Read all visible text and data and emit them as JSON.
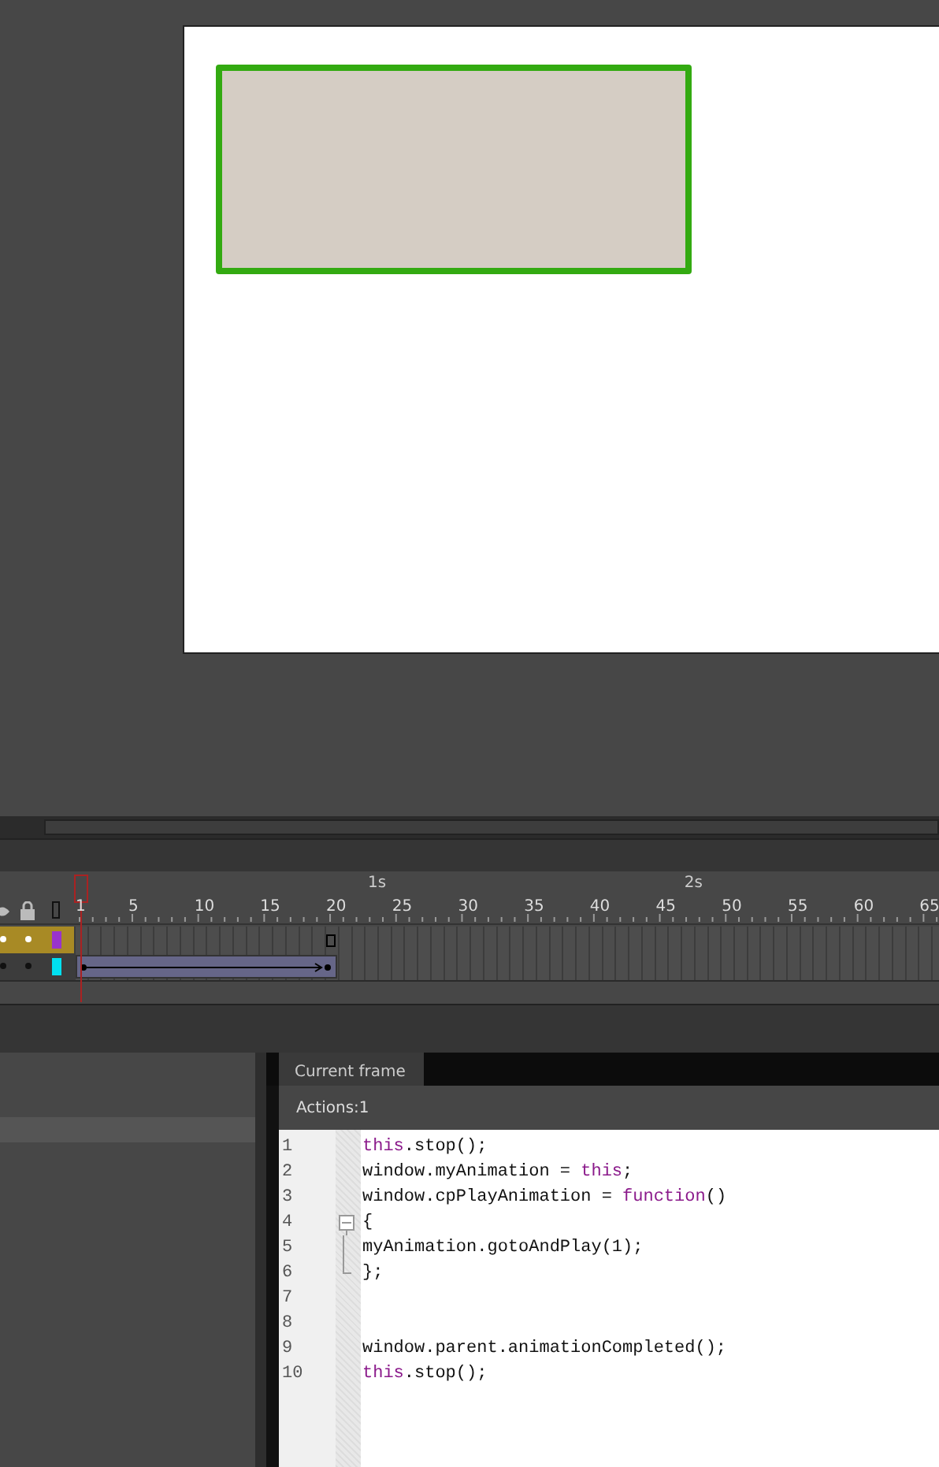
{
  "timeline": {
    "frame_labels": [
      "1",
      "5",
      "10",
      "15",
      "20",
      "25",
      "30",
      "35",
      "40",
      "45",
      "50",
      "55",
      "60",
      "65"
    ],
    "second_labels": [
      "1s",
      "2s"
    ],
    "layers": [
      {
        "color": "#9933cc",
        "selected": true,
        "kind": "keyframe"
      },
      {
        "color": "#00e0f0",
        "selected": false,
        "kind": "tween"
      }
    ]
  },
  "actions": {
    "tabs": [
      {
        "label": "Current frame",
        "selected": true
      }
    ],
    "header": "Actions:1",
    "lines": [
      {
        "number": "1",
        "kind": "plain",
        "tokens": [
          {
            "text": "this",
            "kind": "keyword"
          },
          {
            "text": ".stop();",
            "kind": "plain"
          }
        ]
      },
      {
        "number": "2",
        "kind": "plain",
        "tokens": [
          {
            "text": "window.myAnimation = ",
            "kind": "plain"
          },
          {
            "text": "this",
            "kind": "keyword"
          },
          {
            "text": ";",
            "kind": "plain"
          }
        ]
      },
      {
        "number": "3",
        "kind": "plain",
        "tokens": [
          {
            "text": "window.cpPlayAnimation = ",
            "kind": "plain"
          },
          {
            "text": "function",
            "kind": "keyword"
          },
          {
            "text": "()",
            "kind": "plain"
          }
        ]
      },
      {
        "number": "4",
        "kind": "foldstart",
        "tokens": [
          {
            "text": "{",
            "kind": "plain"
          }
        ]
      },
      {
        "number": "5",
        "kind": "foldinside",
        "tokens": [
          {
            "text": "myAnimation.gotoAndPlay(1);",
            "kind": "plain"
          }
        ]
      },
      {
        "number": "6",
        "kind": "foldend",
        "tokens": [
          {
            "text": "};",
            "kind": "plain"
          }
        ]
      },
      {
        "number": "7",
        "kind": "plain"
      },
      {
        "number": "8",
        "kind": "plain"
      },
      {
        "number": "9",
        "kind": "plain",
        "tokens": [
          {
            "text": "window.parent.animationCompleted();",
            "kind": "plain"
          }
        ]
      },
      {
        "number": "10",
        "kind": "plain",
        "tokens": [
          {
            "text": "this",
            "kind": "keyword"
          },
          {
            "text": ".stop();",
            "kind": "plain"
          }
        ]
      }
    ]
  }
}
